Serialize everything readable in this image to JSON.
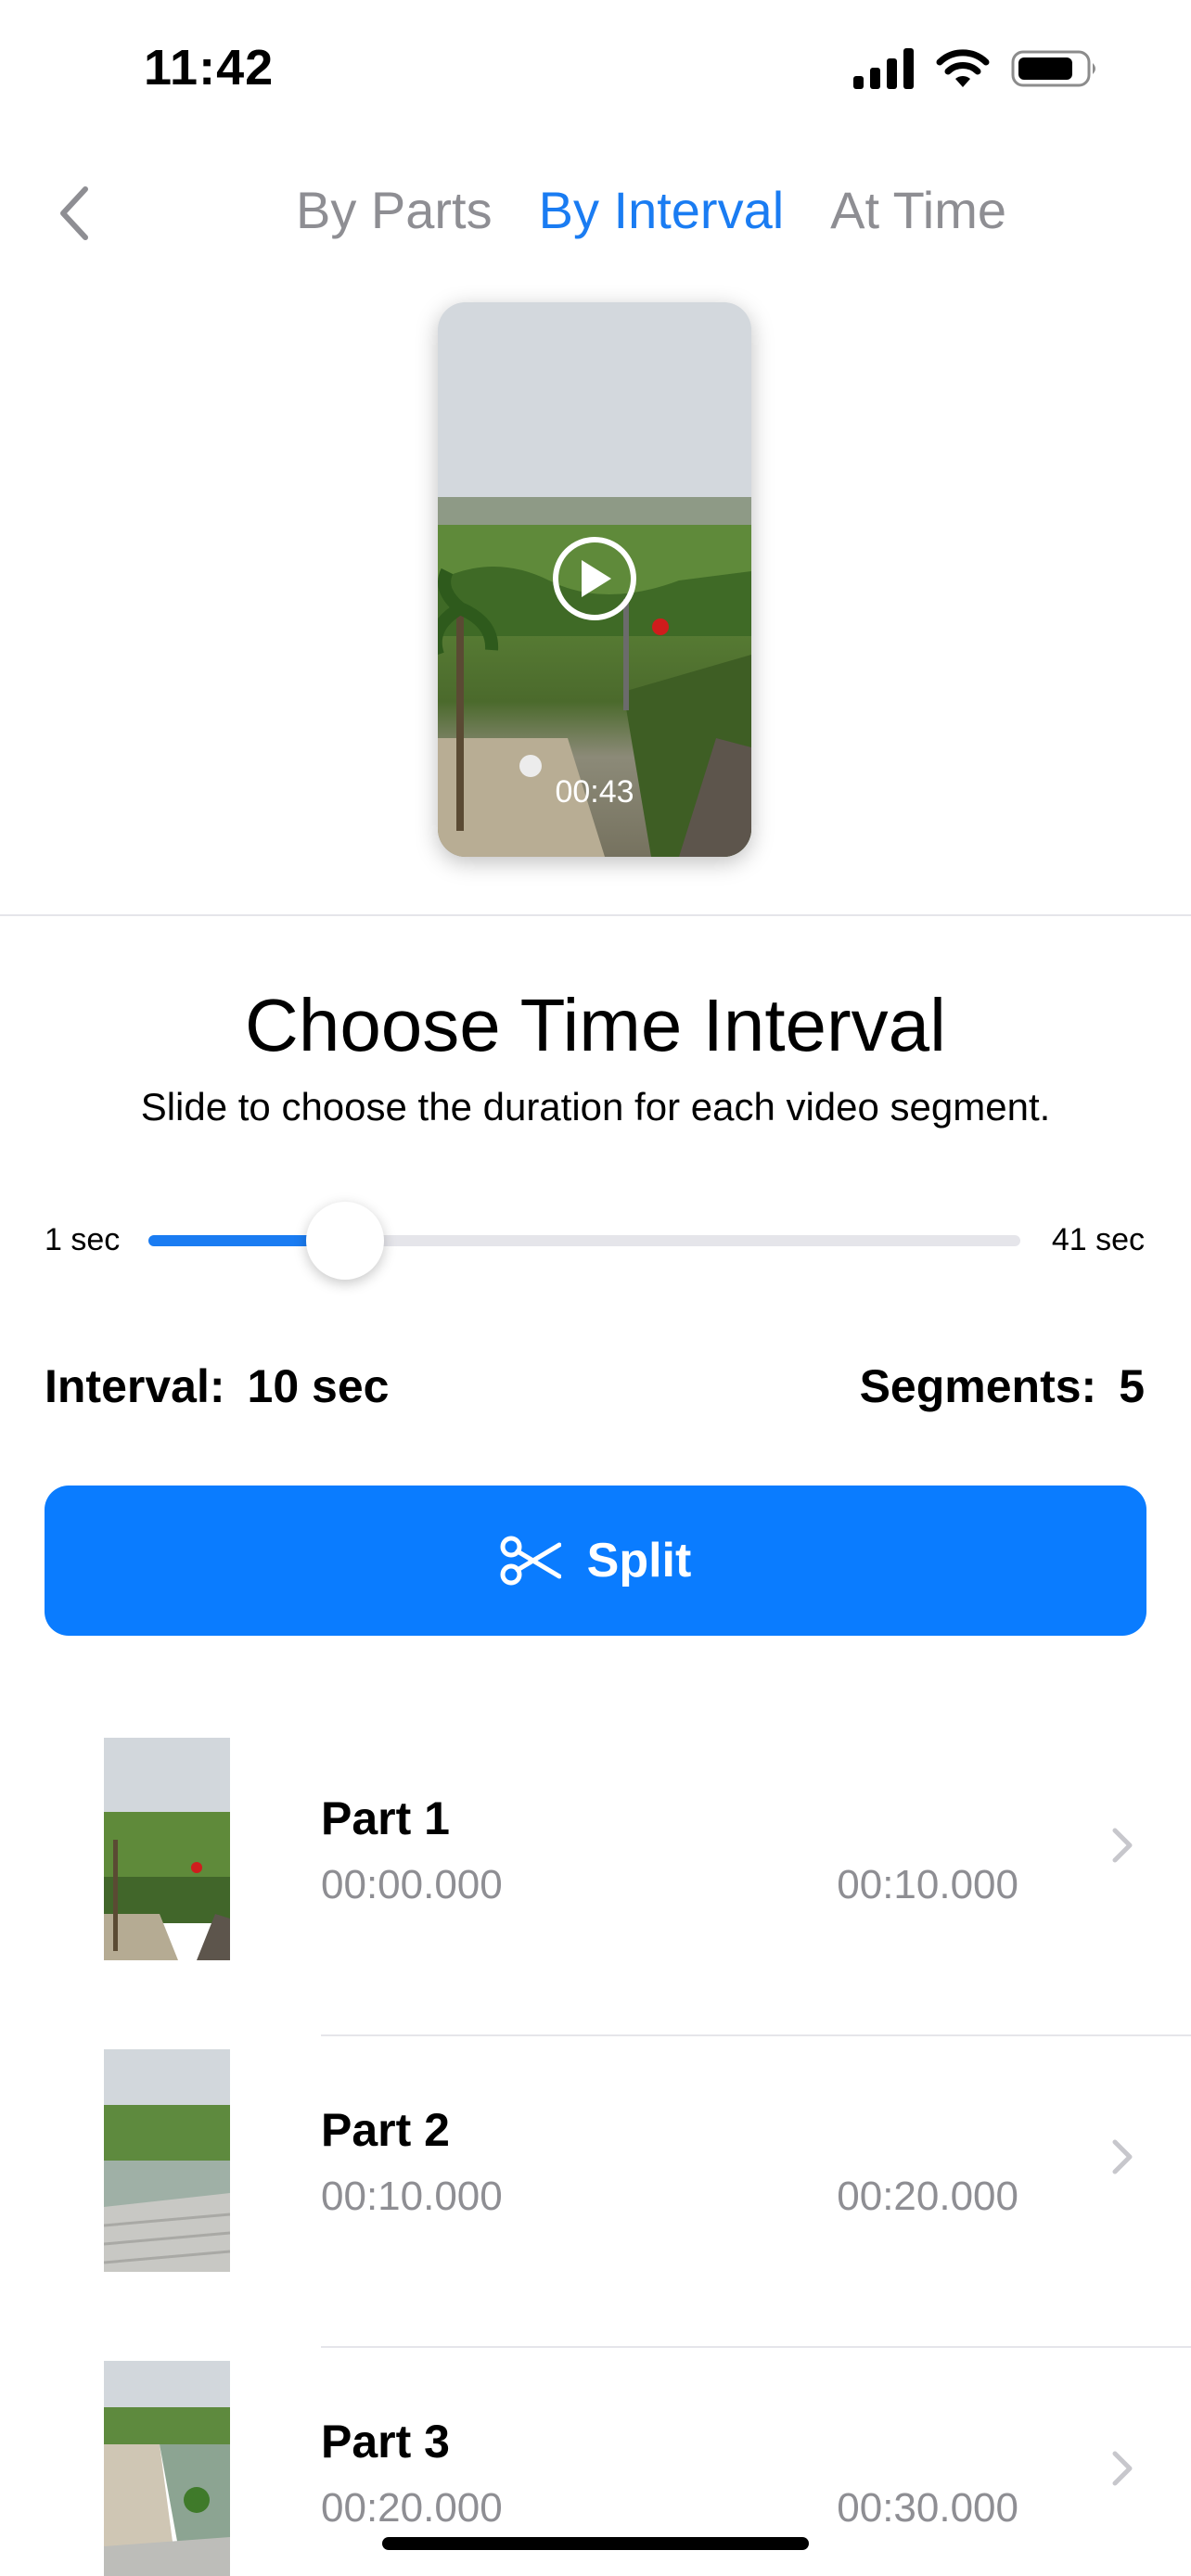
{
  "status_bar": {
    "time": "11:42",
    "icons": [
      "cellular-signal-icon",
      "wifi-icon",
      "battery-icon"
    ]
  },
  "nav": {
    "back_icon": "chevron-left-icon",
    "tabs": [
      {
        "label": "By Parts",
        "active": false
      },
      {
        "label": "By Interval",
        "active": true
      },
      {
        "label": "At Time",
        "active": false
      }
    ]
  },
  "preview": {
    "duration": "00:43",
    "play_icon": "play-icon"
  },
  "heading": {
    "title": "Choose Time Interval",
    "subtitle": "Slide to choose the duration for each video segment."
  },
  "slider": {
    "min_label": "1 sec",
    "max_label": "41 sec",
    "min": 1,
    "max": 41,
    "value": 10
  },
  "summary": {
    "interval_label": "Interval:",
    "interval_value": "10 sec",
    "segments_label": "Segments:",
    "segments_value": "5"
  },
  "split_button": {
    "label": "Split",
    "icon": "scissors-icon"
  },
  "parts": [
    {
      "label": "Part 1",
      "start": "00:00.000",
      "end": "00:10.000"
    },
    {
      "label": "Part 2",
      "start": "00:10.000",
      "end": "00:20.000"
    },
    {
      "label": "Part 3",
      "start": "00:20.000",
      "end": "00:30.000"
    }
  ],
  "colors": {
    "accent": "#0a7cff",
    "tab_active": "#1a7cf2",
    "secondary_text": "#8e8e93"
  }
}
